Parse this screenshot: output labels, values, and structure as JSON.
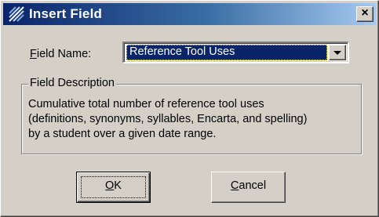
{
  "window": {
    "title": "Insert Field",
    "close_glyph": "×",
    "icon": "app-icon"
  },
  "field_name": {
    "label_accel": "F",
    "label_rest": "ield Name:",
    "selected_value": "Reference Tool Uses"
  },
  "description_group": {
    "title": "Field Description",
    "text_lines": [
      "Cumulative total number of reference tool uses",
      "(definitions, synonyms, syllables, Encarta, and spelling)",
      "by a student over a given date range."
    ]
  },
  "buttons": {
    "ok_accel": "O",
    "ok_rest": "K",
    "cancel_accel": "C",
    "cancel_rest": "ancel"
  },
  "colors": {
    "face": "#D4D0C8",
    "titlebar_start": "#0A246A",
    "titlebar_end": "#A6CAF0",
    "selection": "#0A246A"
  }
}
